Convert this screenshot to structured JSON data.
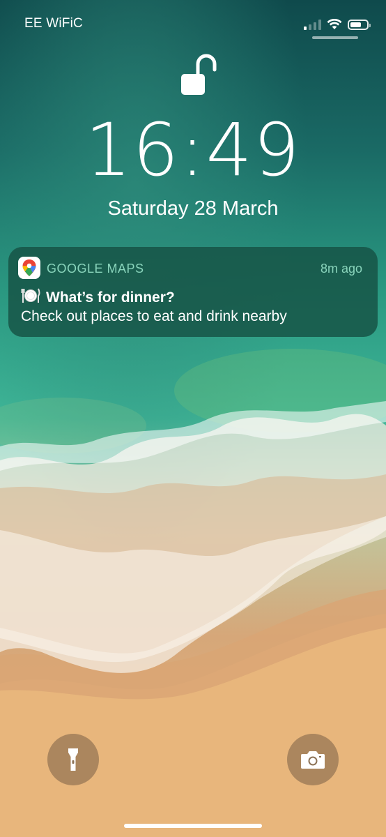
{
  "status_bar": {
    "carrier": "EE WiFiC",
    "signal_bars_active": 1,
    "signal_bars_total": 4,
    "battery_level": 0.7
  },
  "lock_screen": {
    "lock_state": "unlocked",
    "time": "16:49",
    "date": "Saturday 28 March"
  },
  "notification": {
    "app_name": "GOOGLE MAPS",
    "time_ago": "8m ago",
    "title": "What’s for dinner?",
    "body": "Check out places to eat and drink nearby",
    "app_icon": "google-maps-icon"
  },
  "quick_actions": {
    "left": "flashlight-icon",
    "right": "camera-icon"
  },
  "colors": {
    "notification_bg": "#165244",
    "app_name_accent": "#96e1c8"
  }
}
